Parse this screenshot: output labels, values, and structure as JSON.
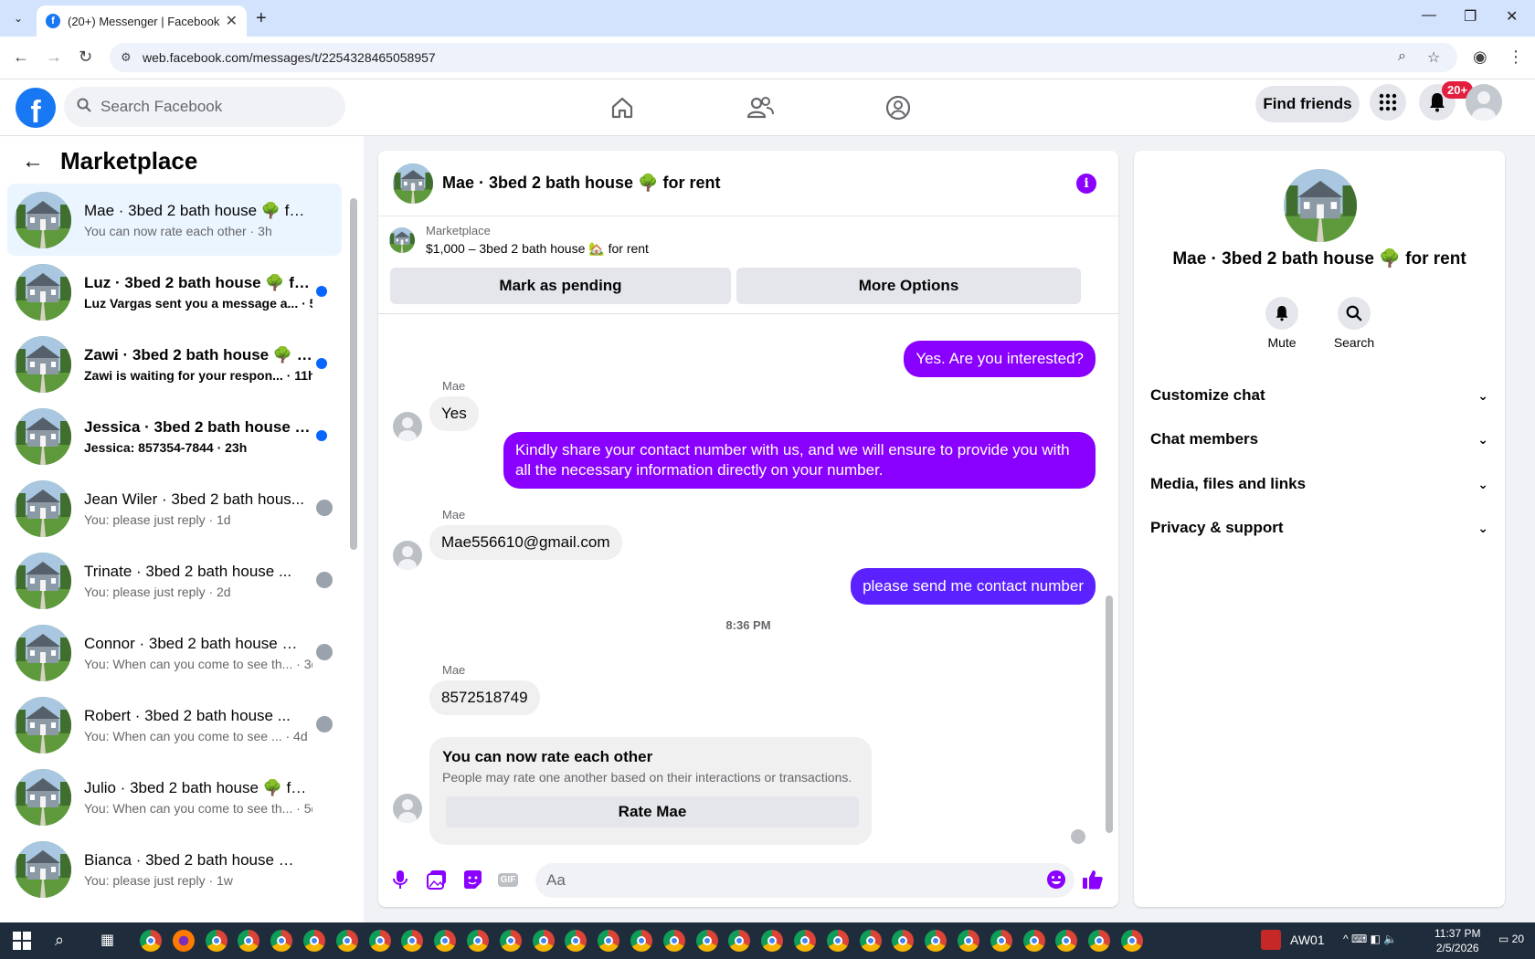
{
  "browser": {
    "tab_title": "(20+) Messenger | Facebook",
    "url": "web.facebook.com/messages/t/2254328465058957",
    "new_tab": "+",
    "close_tab": "✕"
  },
  "header": {
    "search_placeholder": "Search Facebook",
    "find_friends": "Find friends",
    "notif_badge": "20+",
    "logo": "f"
  },
  "sidebar": {
    "title": "Marketplace",
    "conversations": [
      {
        "name": "Mae · 3bed 2 bath house 🌳 for ...",
        "sub": "You can now rate each other · 3h",
        "active": true,
        "unread": false
      },
      {
        "name": "Luz · 3bed 2 bath house 🌳 for...",
        "sub": "Luz Vargas sent you a message a... · 5h",
        "unread": true
      },
      {
        "name": "Zawi · 3bed 2 bath house 🌳 f...",
        "sub": "Zawi is waiting for your respon... · 11h",
        "unread": true
      },
      {
        "name": "Jessica · 3bed 2 bath house 🌳...",
        "sub": "Jessica: 857354-7844 · 23h",
        "unread": true
      },
      {
        "name": "Jean Wiler · 3bed 2 bath hous...",
        "sub": "You: please just reply · 1d",
        "unread": false
      },
      {
        "name": "Trinate · 3bed 2 bath house ...",
        "sub": "You: please just reply · 2d",
        "unread": false
      },
      {
        "name": "Connor · 3bed 2 bath house 🌳 f...",
        "sub": "You: When can you come to see th... · 3d",
        "unread": false
      },
      {
        "name": "Robert · 3bed 2 bath house ...",
        "sub": "You: When can you come to see ... · 4d",
        "unread": false
      },
      {
        "name": "Julio · 3bed 2 bath house 🌳 for ...",
        "sub": "You: When can you come to see th... · 5d",
        "unread": false
      },
      {
        "name": "Bianca · 3bed 2 bath house 🌳 f...",
        "sub": "You: please just reply · 1w",
        "unread": false
      }
    ]
  },
  "chat": {
    "title": "Mae · 3bed 2 bath house 🌳 for rent",
    "marketplace_label": "Marketplace",
    "listing": "$1,000 – 3bed 2 bath house 🏡 for rent",
    "mark_pending": "Mark as pending",
    "more_options": "More Options",
    "messages": {
      "out1": "Yes. Are you interested?",
      "sender": "Mae",
      "in1": "Yes",
      "out2": "Kindly share your contact number with us, and we will ensure to provide you with all the necessary information directly on your number.",
      "in2": "Mae556610@gmail.com",
      "out3": "please send me contact  number",
      "time": "8:36 PM",
      "in3": "8572518749"
    },
    "rate_title": "You can now rate each other",
    "rate_sub": "People may rate one another based on their interactions or transactions.",
    "rate_button": "Rate Mae",
    "composer_placeholder": "Aa",
    "gif": "GIF"
  },
  "right_panel": {
    "title": "Mae · 3bed 2 bath house 🌳 for rent",
    "mute": "Mute",
    "search": "Search",
    "sections": [
      "Customize chat",
      "Chat members",
      "Media, files and links",
      "Privacy & support"
    ]
  },
  "taskbar": {
    "user": "AW01",
    "time": "11:37 PM",
    "date": "2/5/2026",
    "notif_count": "20"
  },
  "colors": {
    "accent": "#8a00ff",
    "fb_blue": "#1877f2",
    "unread_dot": "#0866ff"
  }
}
